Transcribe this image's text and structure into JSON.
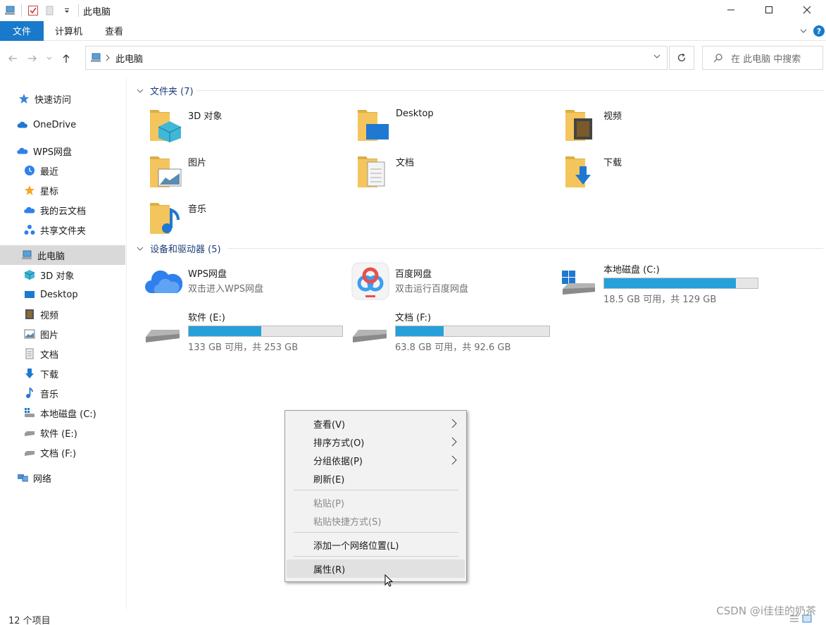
{
  "window": {
    "title": "此电脑"
  },
  "ribbon": {
    "tabs": [
      "文件",
      "计算机",
      "查看"
    ],
    "help": "?"
  },
  "address": {
    "crumb": "此电脑",
    "search_placeholder": "在 此电脑 中搜索"
  },
  "sidebar": {
    "items": [
      {
        "label": "快速访问",
        "icon": "star-icon"
      },
      {
        "label": "OneDrive",
        "icon": "onedrive-cloud-icon"
      },
      {
        "label": "WPS网盘",
        "icon": "wps-cloud-icon"
      },
      {
        "label": "最近",
        "icon": "recent-clock-icon"
      },
      {
        "label": "星标",
        "icon": "star-orange-icon"
      },
      {
        "label": "我的云文档",
        "icon": "cloud-doc-icon"
      },
      {
        "label": "共享文件夹",
        "icon": "share-folder-icon"
      },
      {
        "label": "此电脑",
        "icon": "this-pc-icon"
      },
      {
        "label": "3D 对象",
        "icon": "cube-icon"
      },
      {
        "label": "Desktop",
        "icon": "desktop-icon"
      },
      {
        "label": "视频",
        "icon": "video-icon"
      },
      {
        "label": "图片",
        "icon": "picture-icon"
      },
      {
        "label": "文档",
        "icon": "document-icon"
      },
      {
        "label": "下载",
        "icon": "download-icon"
      },
      {
        "label": "音乐",
        "icon": "music-icon"
      },
      {
        "label": "本地磁盘 (C:)",
        "icon": "drive-c-icon"
      },
      {
        "label": "软件 (E:)",
        "icon": "drive-icon"
      },
      {
        "label": "文档 (F:)",
        "icon": "drive-icon"
      },
      {
        "label": "网络",
        "icon": "network-icon"
      }
    ]
  },
  "folders": {
    "header": "文件夹 (7)",
    "items": [
      "3D 对象",
      "Desktop",
      "视频",
      "图片",
      "文档",
      "下载",
      "音乐"
    ]
  },
  "devices": {
    "header": "设备和驱动器 (5)",
    "items": [
      {
        "name": "WPS网盘",
        "sub": "双击进入WPS网盘"
      },
      {
        "name": "百度网盘",
        "sub": "双击运行百度网盘"
      },
      {
        "name": "本地磁盘 (C:)",
        "sub": "18.5 GB 可用，共 129 GB",
        "used_fraction": 0.857
      },
      {
        "name": "软件 (E:)",
        "sub": "133 GB 可用，共 253 GB",
        "used_fraction": 0.474
      },
      {
        "name": "文档 (F:)",
        "sub": "63.8 GB 可用，共 92.6 GB",
        "used_fraction": 0.311
      }
    ]
  },
  "context_menu": {
    "items": [
      {
        "label": "查看(V)",
        "submenu": true
      },
      {
        "label": "排序方式(O)",
        "submenu": true
      },
      {
        "label": "分组依据(P)",
        "submenu": true
      },
      {
        "label": "刷新(E)"
      },
      {
        "label": "粘贴(P)",
        "disabled": true
      },
      {
        "label": "粘贴快捷方式(S)",
        "disabled": true
      },
      {
        "label": "添加一个网络位置(L)"
      },
      {
        "label": "属性(R)"
      }
    ]
  },
  "status": {
    "count": "12 个项目"
  },
  "watermark": "CSDN @i佳佳的奶茶",
  "colors": {
    "accent": "#1979ca",
    "drive_bar": "#26a0da",
    "folder": "#f4c55d"
  }
}
